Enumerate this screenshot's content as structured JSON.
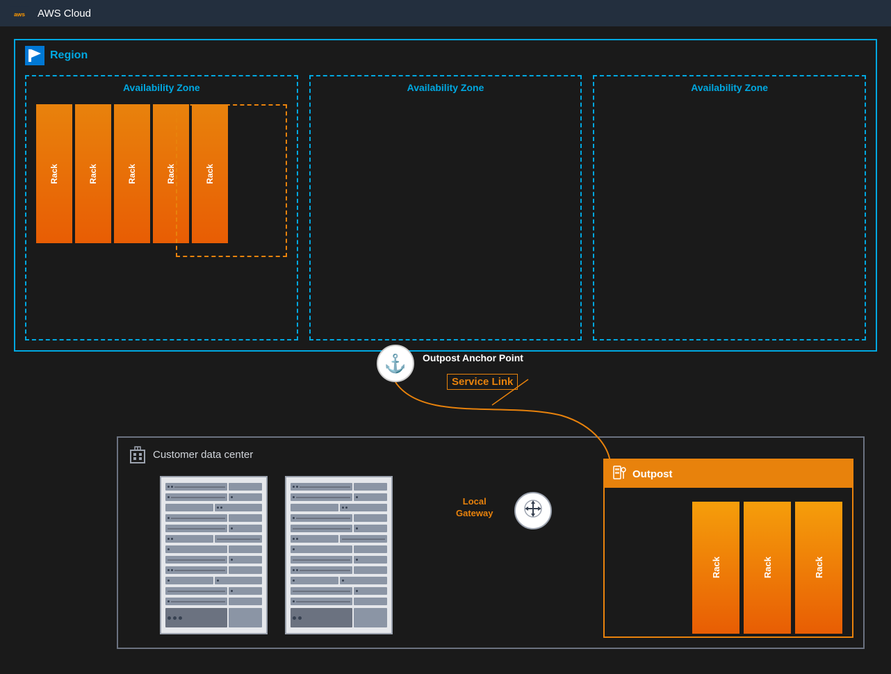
{
  "header": {
    "aws_label": "AWS Cloud"
  },
  "region": {
    "label": "Region"
  },
  "availability_zones": [
    {
      "label": "Availability Zone",
      "has_racks": true
    },
    {
      "label": "Availability Zone",
      "has_racks": false
    },
    {
      "label": "Availability Zone",
      "has_racks": false
    }
  ],
  "racks": [
    "Rack",
    "Rack",
    "Rack",
    "Rack",
    "Rack"
  ],
  "outpost_anchor": {
    "label": "Outpost Anchor Point",
    "icon": "⚓"
  },
  "service_link": {
    "label": "Service Link"
  },
  "datacenter": {
    "label": "Customer data center"
  },
  "outpost": {
    "label": "Outpost",
    "racks": [
      "Rack",
      "Rack",
      "Rack"
    ]
  },
  "local_gateway": {
    "label": "Local\nGateway"
  }
}
